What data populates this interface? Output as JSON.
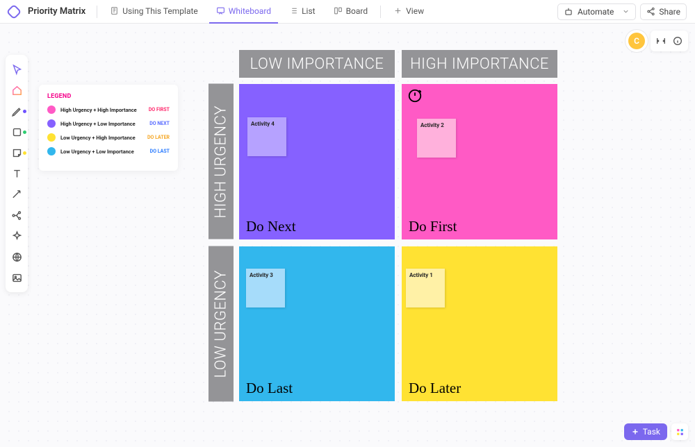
{
  "header": {
    "title": "Priority Matrix",
    "tabs": {
      "template": "Using This Template",
      "whiteboard": "Whiteboard",
      "list": "List",
      "board": "Board",
      "view": "View"
    },
    "automate": "Automate",
    "share": "Share"
  },
  "avatar": {
    "initial": "C"
  },
  "legend": {
    "title": "LEGEND",
    "items": [
      {
        "label": "High Urgency + High Importance",
        "tag": "DO FIRST",
        "color": "#ff5ac5",
        "tagColor": "#ff2a6d"
      },
      {
        "label": "High Urgency + Low Importance",
        "tag": "DO NEXT",
        "color": "#8661ff",
        "tagColor": "#5a6cff"
      },
      {
        "label": "Low Urgency + High Importance",
        "tag": "DO LATER",
        "color": "#ffe233",
        "tagColor": "#f5a623"
      },
      {
        "label": "Low Urgency + Low Importance",
        "tag": "DO LAST",
        "color": "#32b7ed",
        "tagColor": "#2a7bff"
      }
    ]
  },
  "matrix": {
    "cols": {
      "left": "LOW IMPORTANCE",
      "right": "HIGH IMPORTANCE"
    },
    "rows": {
      "top": "HIGH URGENCY",
      "bottom": "LOW URGENCY"
    },
    "q": {
      "tl": {
        "label": "Do Next",
        "note": "Activity 4"
      },
      "tr": {
        "label": "Do First",
        "note": "Activity 2"
      },
      "bl": {
        "label": "Do Last",
        "note": "Activity 3"
      },
      "br": {
        "label": "Do Later",
        "note": "Activity 1"
      }
    }
  },
  "task_button": "Task"
}
